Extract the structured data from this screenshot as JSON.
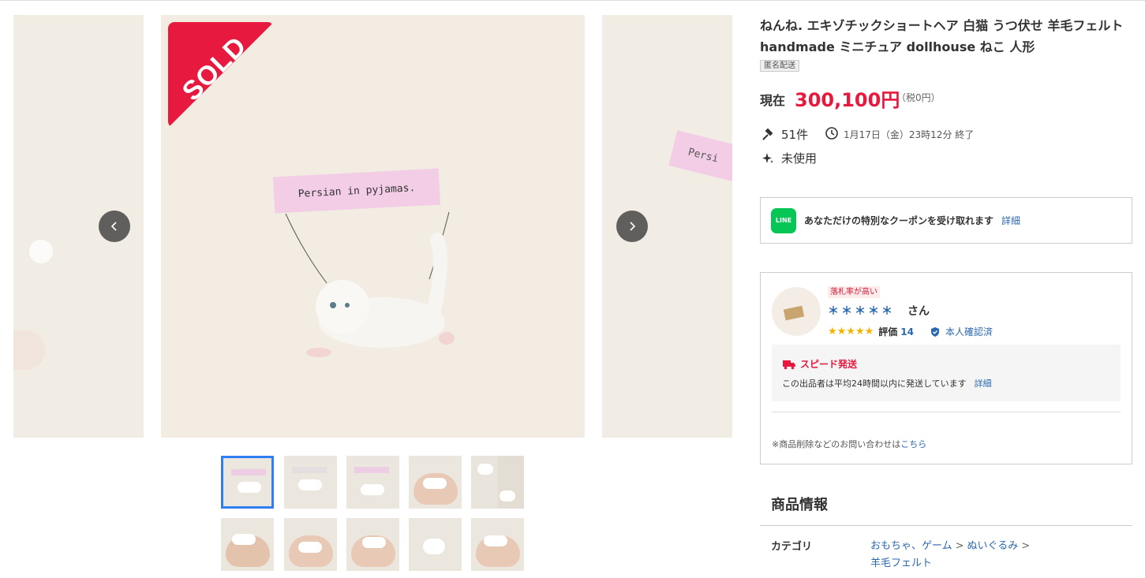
{
  "gallery": {
    "sold_badge": "SOLD",
    "main_banner_text": "Persian in pyjamas.",
    "right_banner_text": "Persi",
    "thumbnail_count": 10
  },
  "product": {
    "title": "ねんね. エキゾチックショートヘア 白猫 うつ伏せ 羊毛フェルト handmade ミニチュア dollhouse ねこ 人形",
    "tag": "匿名配送",
    "price_label": "現在",
    "price": "300,100円",
    "tax": "（税0円）",
    "bids": "51件",
    "end_time": "1月17日（金）23時12分 終了",
    "condition": "未使用"
  },
  "line": {
    "logo_text": "LINE",
    "message": "あなただけの特別なクーポンを受け取れます",
    "details": "詳細"
  },
  "seller": {
    "tag": "落札率が高い",
    "name": "＊＊＊＊＊",
    "suffix": "さん",
    "stars": "★★★★★",
    "rating_label": "評価",
    "rating_value": "14",
    "verified": "本人確認済",
    "speed_title": "スピード発送",
    "speed_desc": "この出品者は平均24時間以内に発送しています",
    "speed_details": "詳細",
    "contact_prefix": "※商品削除などのお問い合わせは",
    "contact_link": "こちら"
  },
  "info": {
    "section_title": "商品情報",
    "category_label": "カテゴリ",
    "category_path": [
      "おもちゃ、ゲーム",
      "ぬいぐるみ",
      "羊毛フェルト"
    ]
  },
  "colors": {
    "accent_red": "#e8193f",
    "link_blue": "#2b68b0",
    "line_green": "#06c755",
    "thumb_active": "#2f7ef2"
  }
}
